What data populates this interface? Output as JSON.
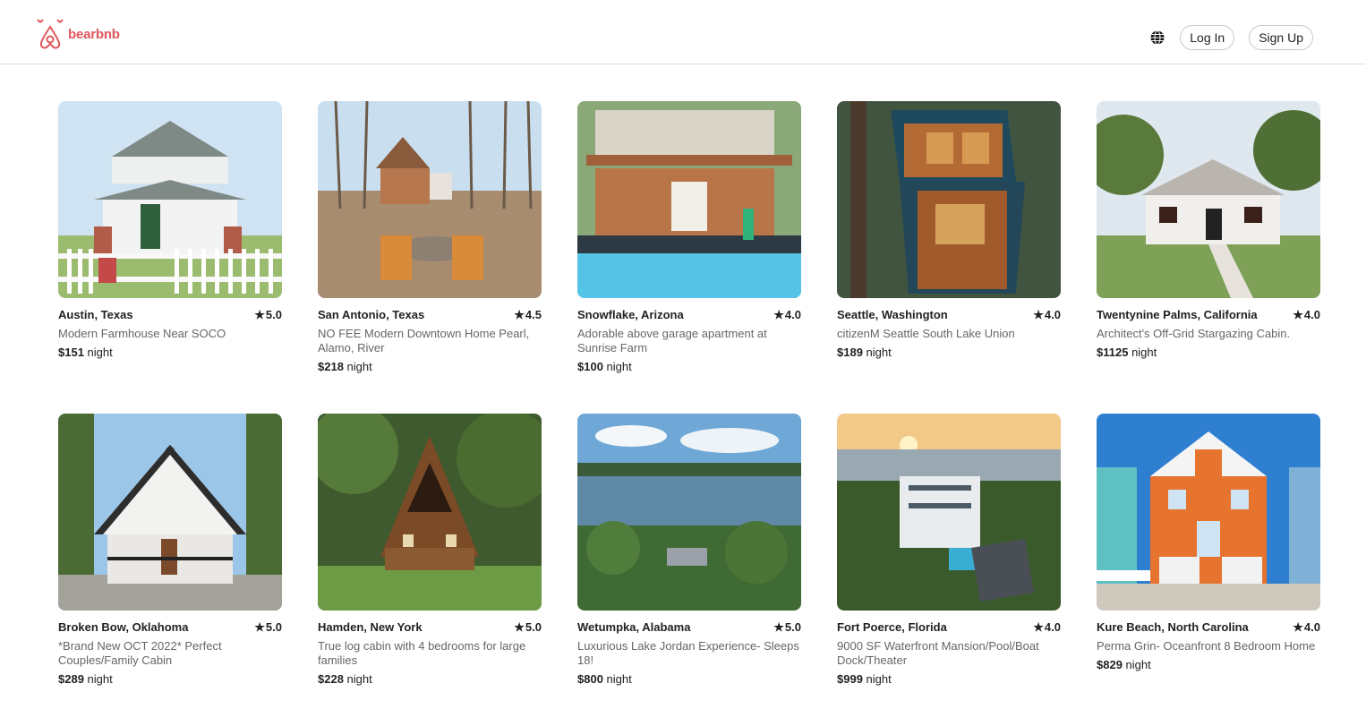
{
  "header": {
    "brand": "bearbnb",
    "login_label": "Log In",
    "signup_label": "Sign Up",
    "globe_icon": "globe-icon",
    "accent_color": "#e0565b"
  },
  "price_suffix": "night",
  "listings": [
    {
      "location": "Austin, Texas",
      "rating": "5.0",
      "title": "Modern Farmhouse Near SOCO",
      "price": "$151"
    },
    {
      "location": "San Antonio, Texas",
      "rating": "4.5",
      "title": "NO FEE Modern Downtown Home Pearl, Alamo, River",
      "price": "$218"
    },
    {
      "location": "Snowflake, Arizona",
      "rating": "4.0",
      "title": "Adorable above garage apartment at Sunrise Farm",
      "price": "$100"
    },
    {
      "location": "Seattle, Washington",
      "rating": "4.0",
      "title": "citizenM Seattle South Lake Union",
      "price": "$189"
    },
    {
      "location": "Twentynine Palms, California",
      "rating": "4.0",
      "title": "Architect's Off-Grid Stargazing Cabin.",
      "price": "$1125"
    },
    {
      "location": "Broken Bow, Oklahoma",
      "rating": "5.0",
      "title": "*Brand New OCT 2022* Perfect Couples/Family Cabin",
      "price": "$289"
    },
    {
      "location": "Hamden, New York",
      "rating": "5.0",
      "title": "True log cabin with 4 bedrooms for large families",
      "price": "$228"
    },
    {
      "location": "Wetumpka, Alabama",
      "rating": "5.0",
      "title": "Luxurious Lake Jordan Experience- Sleeps 18!",
      "price": "$800"
    },
    {
      "location": "Fort Poerce, Florida",
      "rating": "4.0",
      "title": "9000 SF Waterfront Mansion/Pool/Boat Dock/Theater",
      "price": "$999"
    },
    {
      "location": "Kure Beach, North Carolina",
      "rating": "4.0",
      "title": "Perma Grin- Oceanfront 8 Bedroom Home",
      "price": "$829"
    }
  ]
}
